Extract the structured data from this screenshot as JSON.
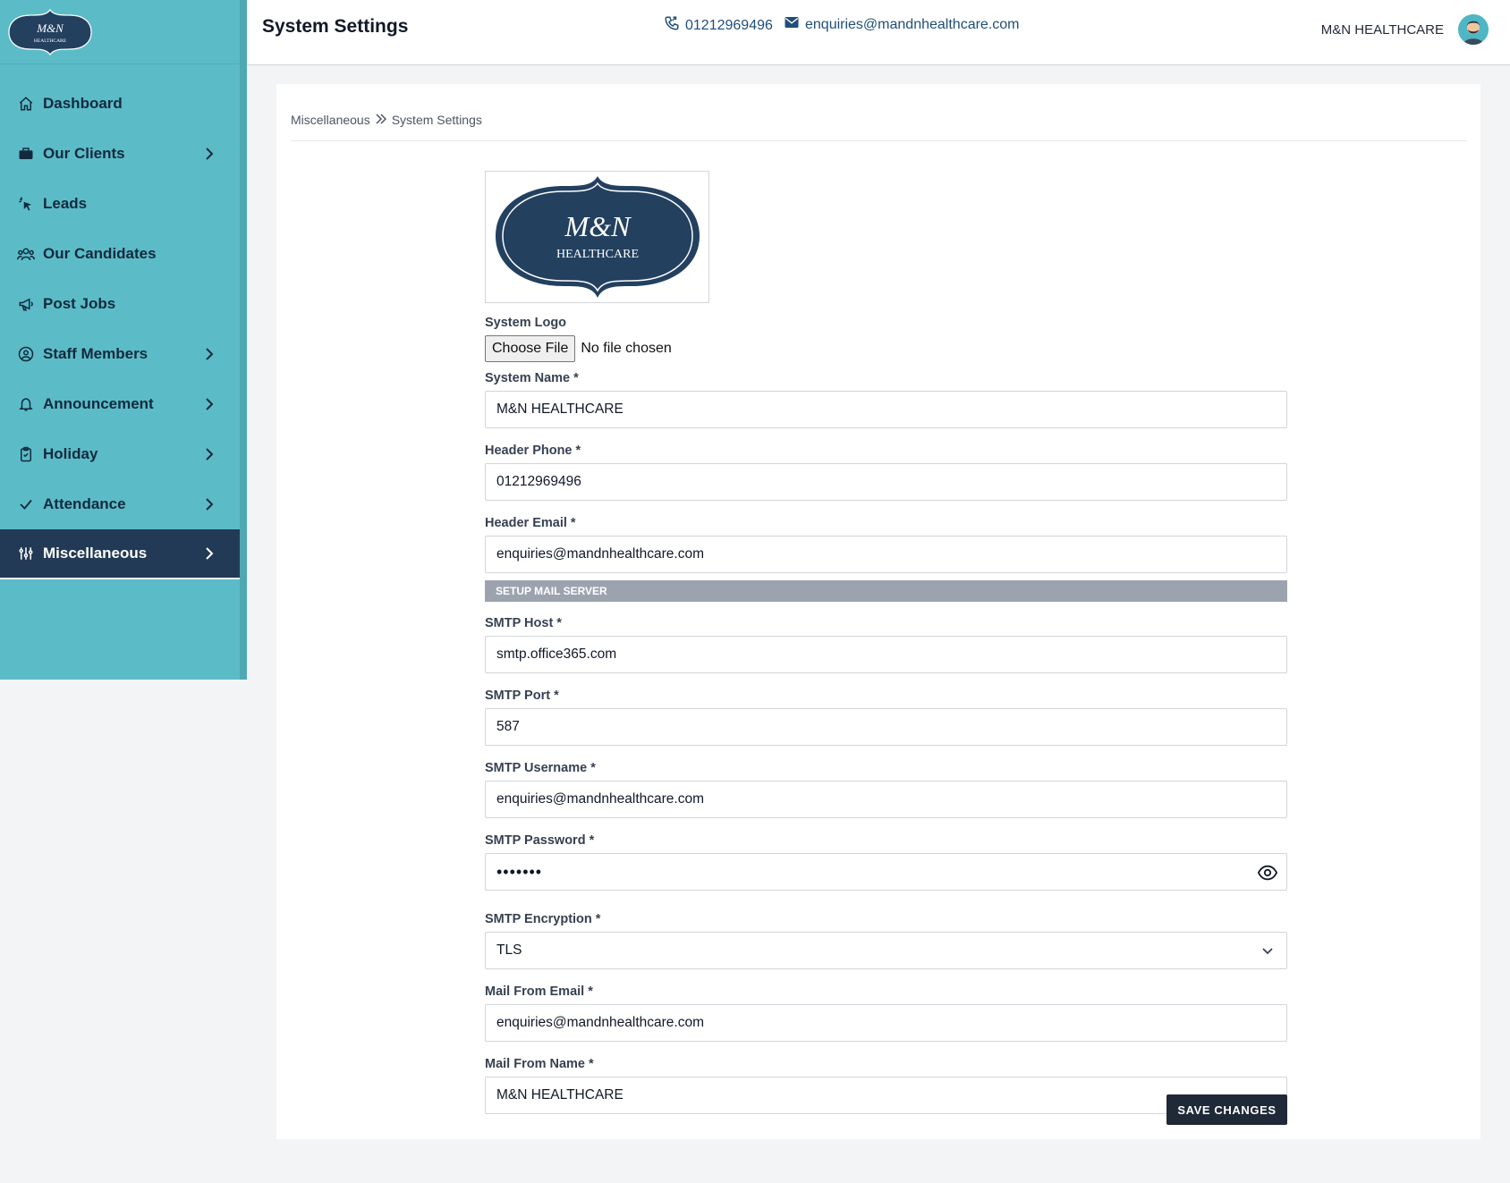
{
  "brand": {
    "logo_line1": "M&N",
    "logo_line2": "HEALTHCARE"
  },
  "sidebar": {
    "items": [
      {
        "label": "Dashboard",
        "icon": "home-icon",
        "has_chevron": false
      },
      {
        "label": "Our Clients",
        "icon": "briefcase-icon",
        "has_chevron": true
      },
      {
        "label": "Leads",
        "icon": "cursor-click-icon",
        "has_chevron": false
      },
      {
        "label": "Our Candidates",
        "icon": "users-icon",
        "has_chevron": false
      },
      {
        "label": "Post Jobs",
        "icon": "megaphone-icon",
        "has_chevron": false
      },
      {
        "label": "Staff Members",
        "icon": "user-circle-icon",
        "has_chevron": true
      },
      {
        "label": "Announcement",
        "icon": "bell-icon",
        "has_chevron": true
      },
      {
        "label": "Holiday",
        "icon": "clipboard-check-icon",
        "has_chevron": true
      },
      {
        "label": "Attendance",
        "icon": "check-icon",
        "has_chevron": true
      },
      {
        "label": "Miscellaneous",
        "icon": "sliders-icon",
        "has_chevron": true,
        "active": true
      }
    ]
  },
  "header": {
    "title": "System Settings",
    "phone": "01212969496",
    "email": "enquiries@mandnhealthcare.com",
    "user_name": "M&N HEALTHCARE"
  },
  "breadcrumb": {
    "parent": "Miscellaneous",
    "current": "System Settings"
  },
  "form": {
    "logo_label": "System Logo",
    "file_button": "Choose File",
    "file_status": "No file chosen",
    "system_name_label": "System Name *",
    "system_name": "M&N HEALTHCARE",
    "header_phone_label": "Header Phone *",
    "header_phone": "01212969496",
    "header_email_label": "Header Email *",
    "header_email": "enquiries@mandnhealthcare.com",
    "section_title": "SETUP MAIL SERVER",
    "smtp_host_label": "SMTP Host *",
    "smtp_host": "smtp.office365.com",
    "smtp_port_label": "SMTP Port *",
    "smtp_port": "587",
    "smtp_username_label": "SMTP Username *",
    "smtp_username": "enquiries@mandnhealthcare.com",
    "smtp_password_label": "SMTP Password *",
    "smtp_password_masked": "•••••••",
    "smtp_encryption_label": "SMTP Encryption *",
    "smtp_encryption": "TLS",
    "mail_from_email_label": "Mail From Email *",
    "mail_from_email": "enquiries@mandnhealthcare.com",
    "mail_from_name_label": "Mail From Name *",
    "mail_from_name": "M&N HEALTHCARE",
    "save_label": "SAVE CHANGES"
  },
  "colors": {
    "sidebar_bg": "#5bbcc8",
    "active_bg": "#223a56",
    "logo_navy": "#23405f",
    "button_bg": "#1f2937",
    "section_bar": "#9ca3af"
  }
}
